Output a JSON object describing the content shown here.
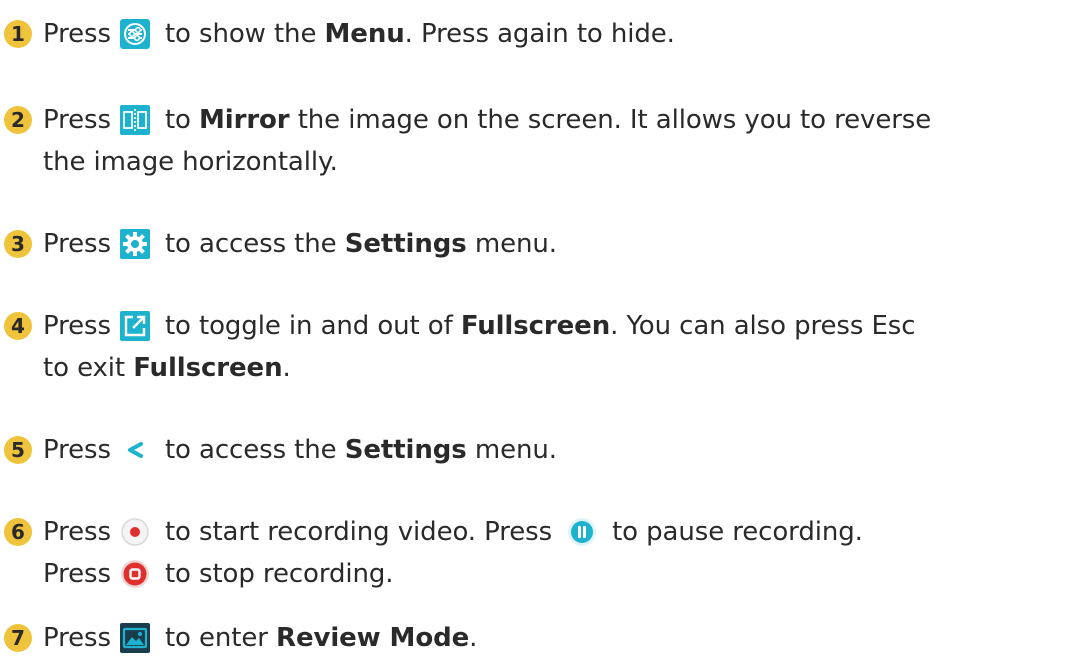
{
  "press": "Press",
  "rows": [
    {
      "num": "1",
      "t1": "to show the",
      "b1": "Menu",
      "t2": ". Press again to hide."
    },
    {
      "num": "2",
      "t1": "to",
      "b1": "Mirror",
      "t2": "the image on the screen. It allows you to reverse",
      "l2": "the image horizontally."
    },
    {
      "num": "3",
      "t1": "to access the",
      "b1": "Settings",
      "t2": "menu."
    },
    {
      "num": "4",
      "t1": "to toggle in and out of",
      "b1": "Fullscreen",
      "t2": ". You can also press Esc",
      "l2a": "to exit",
      "l2b": "Fullscreen",
      "l2c": "."
    },
    {
      "num": "5",
      "t1": "to access the",
      "b1": "Settings",
      "t2": "menu."
    },
    {
      "num": "6",
      "t1": "to start recording video. Press",
      "t2": "to pause recording.",
      "l2a": "Press",
      "l2b": "to stop recording."
    },
    {
      "num": "7",
      "t1": "to enter",
      "b1": "Review Mode",
      "t2": "."
    }
  ],
  "icons": {
    "menu": "menu-sliders-icon",
    "mirror": "mirror-icon",
    "settings": "gear-icon",
    "fullscreen": "fullscreen-icon",
    "back": "chevron-left-icon",
    "record": "record-icon",
    "pause": "pause-icon",
    "stop": "stop-icon",
    "review": "review-gallery-icon"
  },
  "colors": {
    "accent": "#1db3cf",
    "badge": "#f0c33c",
    "record": "#e0302e"
  }
}
